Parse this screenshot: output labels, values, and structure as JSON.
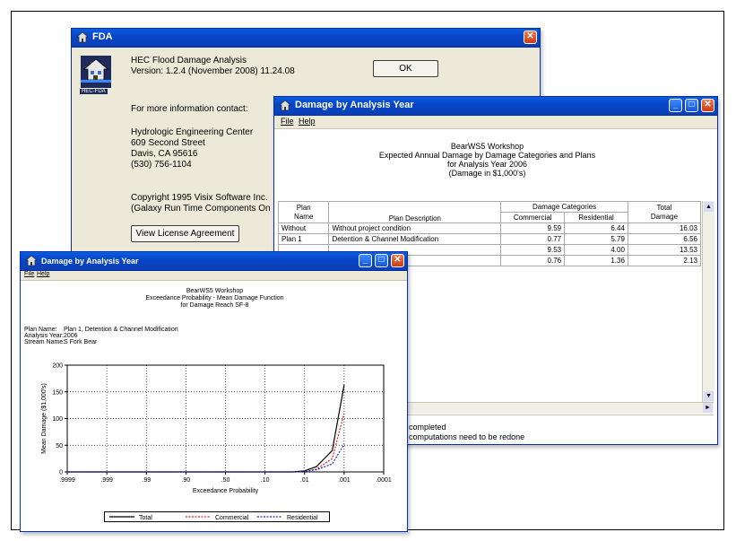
{
  "about": {
    "title": "FDA",
    "app_name": "HEC Flood Damage Analysis",
    "version": "Version:  1.2.4 (November 2008) 11.24.08",
    "ok_label": "OK",
    "logo_text": "HEC-FDA",
    "info_label": "For more information contact:",
    "address": [
      "Hydrologic Engineering Center",
      "609 Second Street",
      "Davis, CA 95616",
      "(530) 756-1104"
    ],
    "copyright": [
      "Copyright 1995 Visix Software Inc.",
      "(Galaxy Run Time Components On"
    ],
    "license_button": "View License Agreement"
  },
  "table_window": {
    "title": "Damage by Analysis Year",
    "menu": [
      "File",
      "Help"
    ],
    "report_title": [
      "BearWS5 Workshop",
      "Expected Annual Damage by Damage Categories and Plans",
      "for Analysis Year 2006",
      "(Damage in $1,000's)"
    ],
    "headers": {
      "plan": "Plan",
      "name": "Name",
      "desc": "Plan Description",
      "cats": "Damage Categories",
      "commercial": "Commercial",
      "residential": "Residential",
      "total": "Total",
      "damage": "Damage"
    },
    "rows": [
      {
        "plan": "Without",
        "desc": "Without project condition",
        "commercial": "9.59",
        "residential": "6.44",
        "total": "16.03"
      },
      {
        "plan": "Plan 1",
        "desc": "Detention & Channel Modification",
        "commercial": "0.77",
        "residential": "5.79",
        "total": "6.56"
      },
      {
        "plan": "",
        "desc": "",
        "commercial": "9.53",
        "residential": "4.00",
        "total": "13.53"
      },
      {
        "plan": "",
        "desc": "odification & Floodwall",
        "commercial": "0.76",
        "residential": "1.36",
        "total": "2.13"
      }
    ],
    "status_lines": [
      "completed",
      "computations need to be redone"
    ]
  },
  "chart_window": {
    "title": "Damage by Analysis Year",
    "menu": [
      "File",
      "Help"
    ],
    "report_title": [
      "BearWS5 Workshop",
      "Exceedance Probability - Mean Damage Function",
      "for Damage Reach SF-8"
    ],
    "info": [
      {
        "label": "Plan Name:",
        "value": "Plan 1, Detention & Channel Modification"
      },
      {
        "label": "Analysis Year:",
        "value": "2006"
      },
      {
        "label": "Stream Name:",
        "value": "S Fork Bear"
      }
    ]
  },
  "chart_data": {
    "type": "line",
    "title": "Exceedance Probability - Mean Damage Function",
    "xlabel": "Exceedance Probability",
    "ylabel": "Mean Damage ($1,000's)",
    "x_scale": "probability",
    "x_ticks": [
      ".9999",
      ".999",
      ".99",
      ".90",
      ".50",
      ".10",
      ".01",
      ".001",
      ".0001"
    ],
    "y_ticks": [
      "0",
      "50",
      "100",
      "150",
      "200"
    ],
    "ylim": [
      0,
      200
    ],
    "grid": true,
    "legend_position": "bottom",
    "series": [
      {
        "name": "Total",
        "color": "#000000",
        "dash": "solid",
        "x": [
          0.9999,
          0.999,
          0.99,
          0.9,
          0.5,
          0.1,
          0.02,
          0.01,
          0.005,
          0.002,
          0.001
        ],
        "values": [
          0,
          0,
          0,
          0,
          0,
          0,
          0,
          2,
          10,
          40,
          163
        ]
      },
      {
        "name": "Commercial",
        "color": "#e02020",
        "dash": "dotted",
        "x": [
          0.9999,
          0.999,
          0.99,
          0.9,
          0.5,
          0.1,
          0.02,
          0.01,
          0.005,
          0.002,
          0.001
        ],
        "values": [
          0,
          0,
          0,
          0,
          0,
          0,
          0,
          1,
          5,
          25,
          110
        ]
      },
      {
        "name": "Residential",
        "color": "#2020d0",
        "dash": "dotted",
        "x": [
          0.9999,
          0.999,
          0.99,
          0.9,
          0.5,
          0.1,
          0.02,
          0.01,
          0.005,
          0.002,
          0.001
        ],
        "values": [
          0,
          0,
          0,
          0,
          0,
          0,
          0,
          1,
          4,
          15,
          52
        ]
      }
    ]
  }
}
